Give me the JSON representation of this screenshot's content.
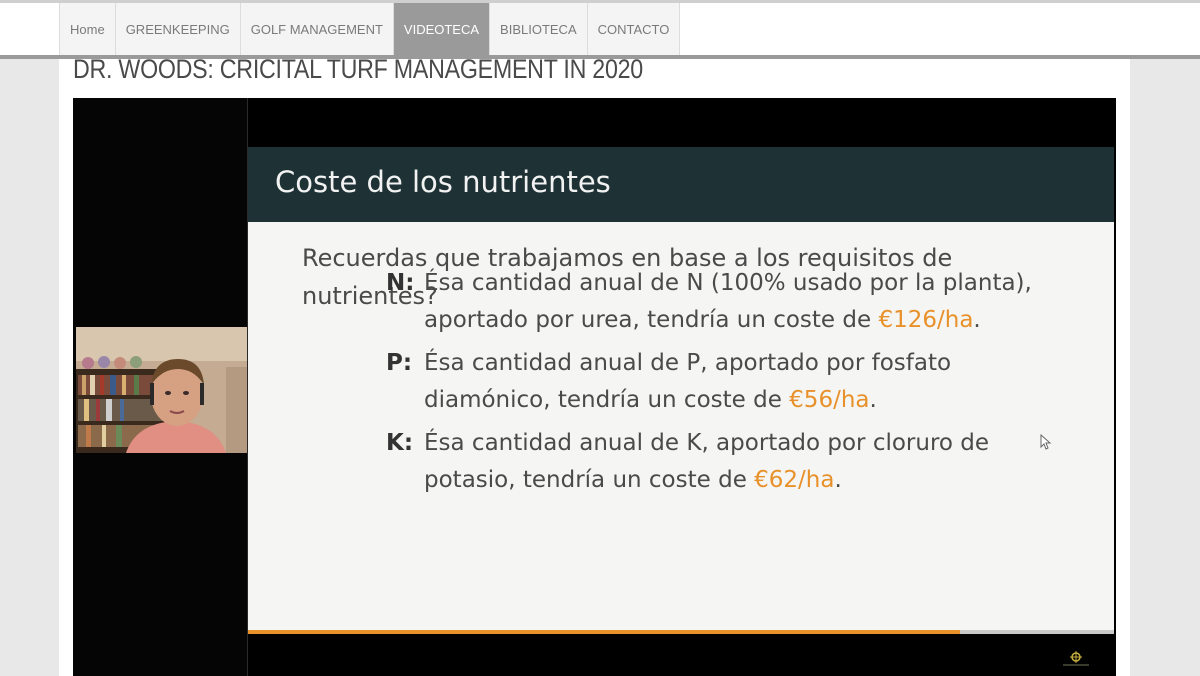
{
  "nav": {
    "items": [
      {
        "label": "Home"
      },
      {
        "label": "GREENKEEPING"
      },
      {
        "label": "GOLF MANAGEMENT"
      },
      {
        "label": "VIDEOTECA"
      },
      {
        "label": "BIBLIOTECA"
      },
      {
        "label": "CONTACTO"
      }
    ],
    "active_index": 3
  },
  "page": {
    "title": "DR. WOODS: CRICITAL TURF MANAGEMENT IN 2020"
  },
  "slide": {
    "title": "Coste de los nutrientes",
    "intro": "Recuerdas que trabajamos en base a los requisitos de nutrientes?",
    "bullets": [
      {
        "letter": "N:",
        "text": "Ésa cantidad anual de N (100% usado por la planta), aportado por urea, tendría un coste de ",
        "price": "€126/ha",
        "end": "."
      },
      {
        "letter": "P:",
        "text": "Ésa cantidad anual de P, aportado por fosfato diamónico, tendría un coste de ",
        "price": "€56/ha",
        "end": "."
      },
      {
        "letter": "K:",
        "text": "Ésa cantidad anual de K, aportado por cloruro de potasio, tendría un coste de ",
        "price": "€62/ha",
        "end": "."
      }
    ]
  },
  "icons": {
    "cursor": "mouse-cursor-icon",
    "logo": "conference-logo-icon"
  },
  "colors": {
    "nav_active": "#9a9a9a",
    "slide_header": "#1e3236",
    "price_accent": "#e8912a"
  }
}
